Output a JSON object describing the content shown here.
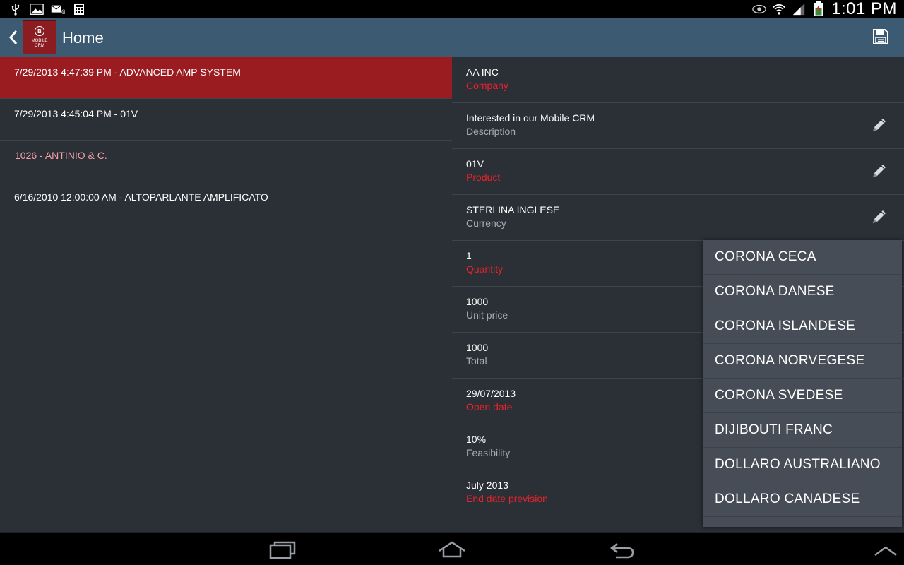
{
  "status_bar": {
    "time": "1:01 PM",
    "left_icons": [
      "usb-icon",
      "image-icon",
      "email-icon",
      "calculator-icon"
    ],
    "right_icons": [
      "eye-icon",
      "wifi-icon",
      "signal-icon",
      "battery-icon"
    ]
  },
  "action_bar": {
    "title": "Home",
    "logo_text_line1": "MOBILE",
    "logo_text_line2": "CRM",
    "logo_letter": "B"
  },
  "list": {
    "items": [
      {
        "label": "7/29/2013 4:47:39 PM - ADVANCED AMP SYSTEM",
        "selected": true
      },
      {
        "label": "7/29/2013 4:45:04 PM - 01V",
        "selected": false
      },
      {
        "label": "1026 - ANTINIO & C.",
        "selected": false
      },
      {
        "label": "6/16/2010 12:00:00 AM - ALTOPARLANTE AMPLIFICATO",
        "selected": false
      }
    ]
  },
  "detail": {
    "fields": [
      {
        "value": "AA INC",
        "label": "Company"
      },
      {
        "value": "Interested in our Mobile CRM",
        "label": "Description"
      },
      {
        "value": "01V",
        "label": "Product"
      },
      {
        "value": "STERLINA INGLESE",
        "label": "Currency"
      },
      {
        "value": "1",
        "label": "Quantity"
      },
      {
        "value": "1000",
        "label": "Unit price"
      },
      {
        "value": "1000",
        "label": "Total"
      },
      {
        "value": "29/07/2013",
        "label": "Open date"
      },
      {
        "value": "10%",
        "label": "Feasibility"
      },
      {
        "value": "July 2013",
        "label": "End date prevision"
      }
    ]
  },
  "dropdown": {
    "options": [
      "CORONA CECA",
      "CORONA DANESE",
      "CORONA ISLANDESE",
      "CORONA NORVEGESE",
      "CORONA SVEDESE",
      "DIJIBOUTI FRANC",
      "DOLLARO AUSTRALIANO",
      "DOLLARO CANADESE"
    ]
  },
  "colors": {
    "selected_row": "#9a1b20",
    "action_bar": "#3d5a73",
    "required_label": "#e8232b",
    "background": "#2b2f36"
  }
}
